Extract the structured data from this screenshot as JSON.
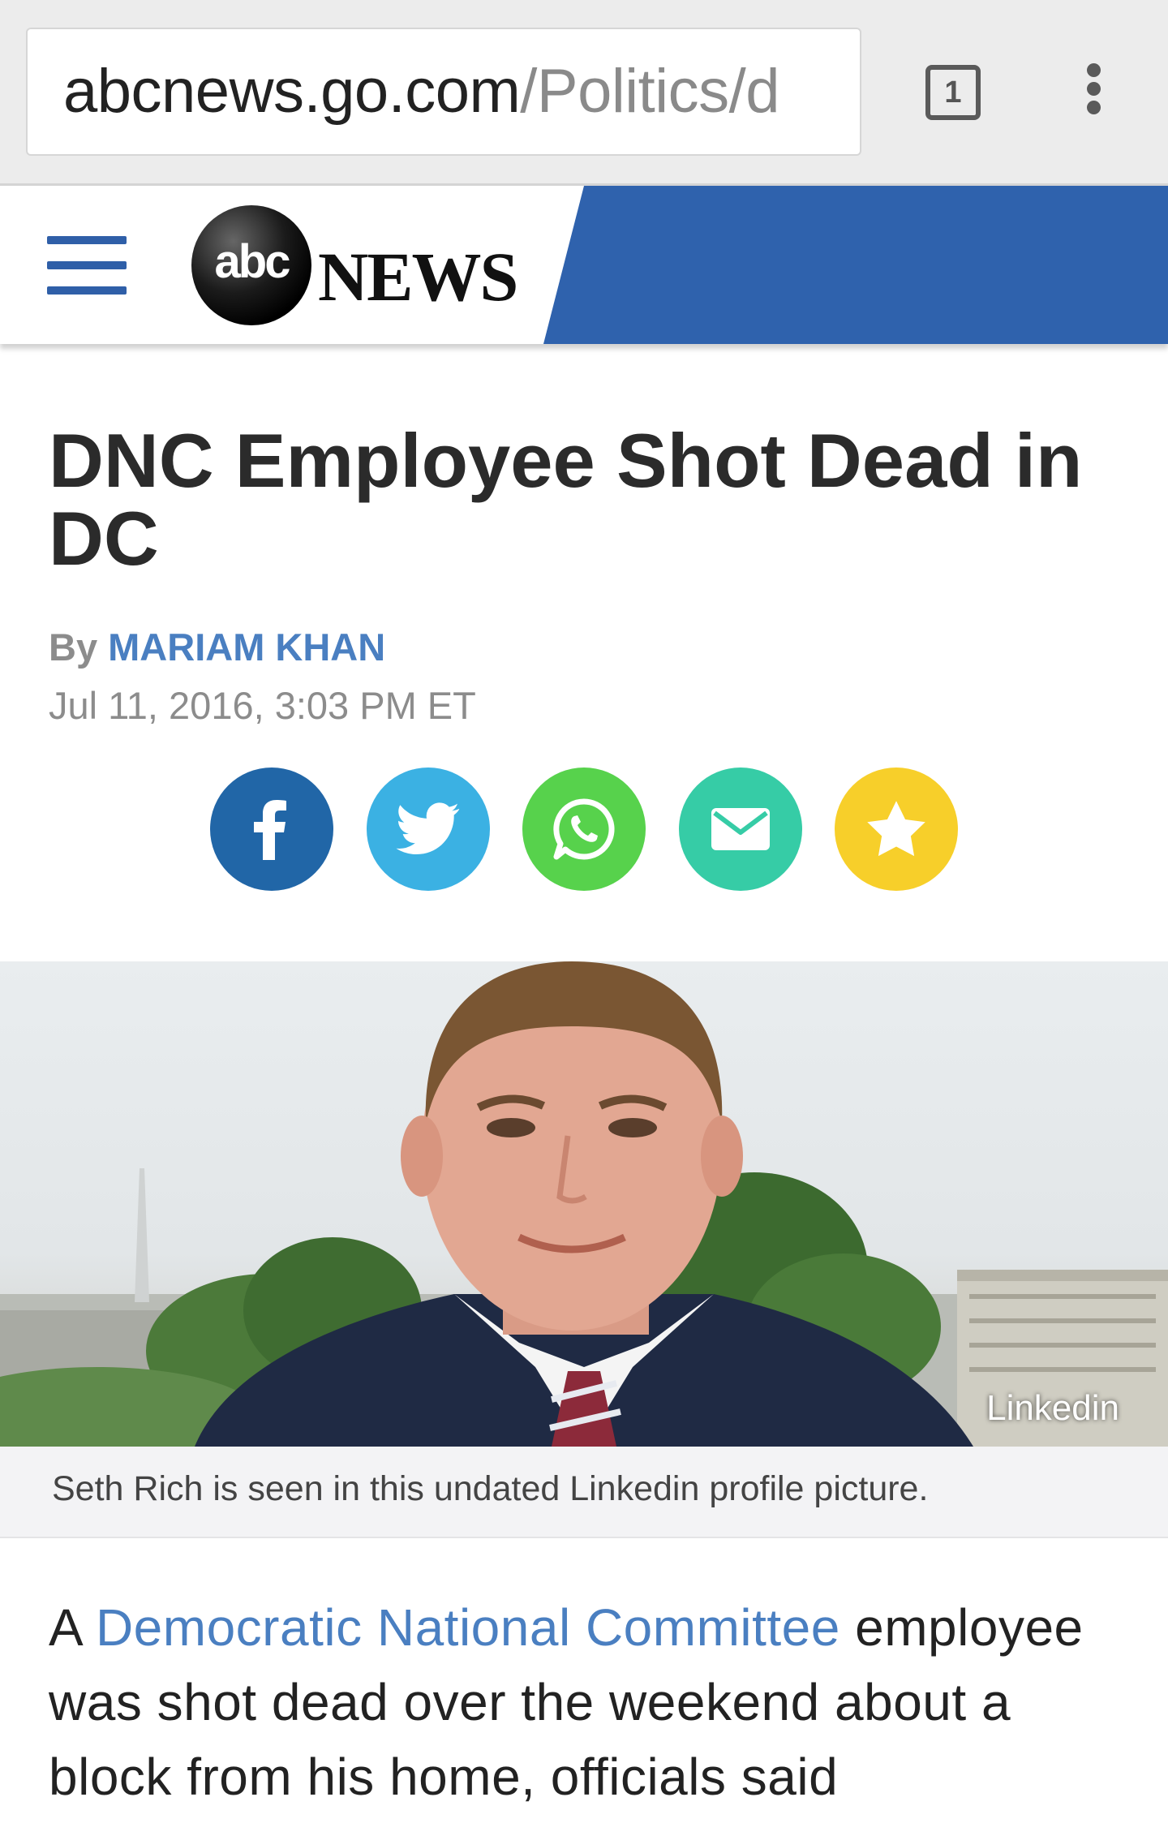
{
  "browser": {
    "url_domain": "abcnews.go.com",
    "url_path": "/Politics/d",
    "tab_count": "1",
    "menu_icon": "overflow-menu-icon"
  },
  "header": {
    "menu_icon": "hamburger-menu-icon",
    "logo_abc": "abc",
    "logo_news": "NEWS",
    "brand_blue": "#2f62ad"
  },
  "article": {
    "headline": "DNC Employee Shot Dead in DC",
    "by_label": "By",
    "author": "MARIAM KHAN",
    "date": "Jul 11, 2016, 3:03 PM ET",
    "share": [
      {
        "name": "facebook",
        "icon": "facebook-icon",
        "color": "#2166a7"
      },
      {
        "name": "twitter",
        "icon": "twitter-icon",
        "color": "#3bb1e3"
      },
      {
        "name": "whatsapp",
        "icon": "whatsapp-icon",
        "color": "#57d24c"
      },
      {
        "name": "email",
        "icon": "email-icon",
        "color": "#36cca6"
      },
      {
        "name": "favorite",
        "icon": "star-icon",
        "color": "#f7cf2a"
      }
    ],
    "photo_credit": "Linkedin",
    "caption": "Seth Rich is seen in this undated Linkedin profile picture.",
    "body_start": "A ",
    "body_link": "Democratic National Committee",
    "body_rest": " employee was shot dead over the weekend about a block from his home, officials said"
  }
}
